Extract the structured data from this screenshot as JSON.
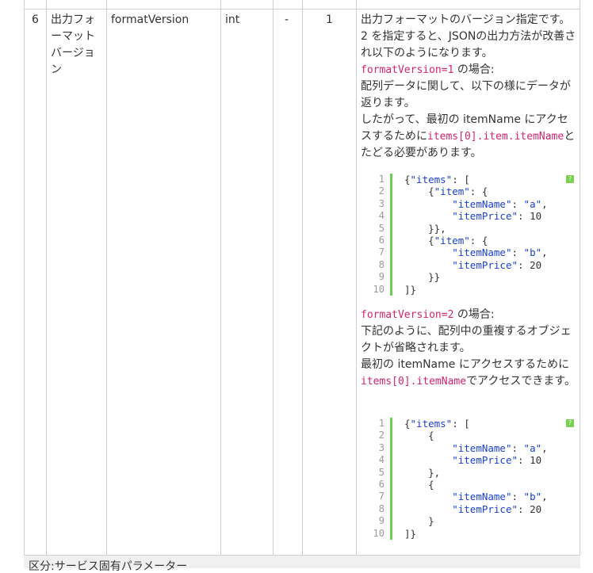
{
  "row": {
    "number": "6",
    "japanese_name": "出力フォーマットバージョン",
    "field_name": "formatVersion",
    "type": "int",
    "required": "-",
    "default": "1"
  },
  "description": {
    "intro_1": "出力フォーマットのバージョン指定です。",
    "intro_2": "2 を指定すると、JSONの出力方法が改善され以下のようになります。",
    "v1_heading_code": "formatVersion=1",
    "v1_heading_suffix": " の場合:",
    "v1_line_1": "配列データに関して、以下の様にデータが返ります。",
    "v1_line_2a": "したがって、最初の itemName にアクセスするために",
    "v1_line_2_code": "items[0].item.itemName",
    "v1_line_2b": "とたどる必要があります。",
    "v2_heading_code": "formatVersion=2",
    "v2_heading_suffix": " の場合:",
    "v2_line_1": "下記のように、配列中の重複するオブジェクトが省略されます。",
    "v2_line_2a": "最初の itemName にアクセスするために",
    "v2_line_2_code": "items[0].itemName",
    "v2_line_2b": "でアクセスできます。"
  },
  "code_block_1": {
    "line_numbers": [
      "1",
      "2",
      "3",
      "4",
      "5",
      "6",
      "7",
      "8",
      "9",
      "10"
    ],
    "help_icon": "?"
  },
  "code_block_2": {
    "line_numbers": [
      "1",
      "2",
      "3",
      "4",
      "5",
      "6",
      "7",
      "8",
      "9",
      "10"
    ],
    "help_icon": "?"
  },
  "footer": {
    "section_label": "区分:サービス固有パラメーター"
  },
  "colors": {
    "inline_code": "#d4246e",
    "code_key": "#1a3fd6",
    "gutter_bar": "#6ccf4f",
    "border": "#cfcfcf"
  }
}
